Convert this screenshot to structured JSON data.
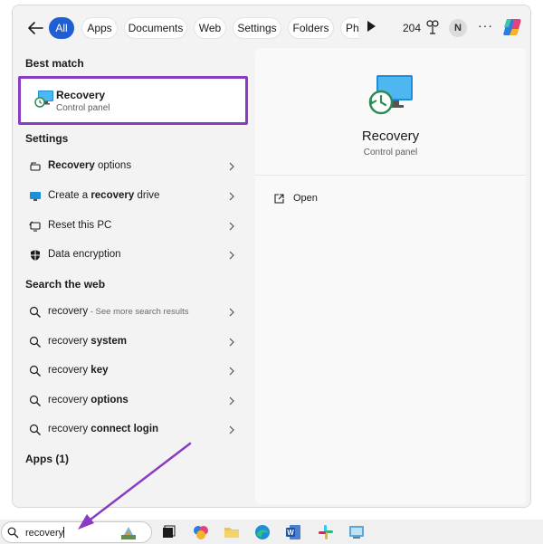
{
  "filters": {
    "tabs": [
      {
        "label": "All",
        "active": true
      },
      {
        "label": "Apps"
      },
      {
        "label": "Documents"
      },
      {
        "label": "Web"
      },
      {
        "label": "Settings"
      },
      {
        "label": "Folders"
      },
      {
        "label": "Ph"
      }
    ],
    "points": "204",
    "avatar_initial": "N",
    "more": "···"
  },
  "best_match": {
    "heading": "Best match",
    "title": "Recovery",
    "subtitle": "Control panel"
  },
  "settings": {
    "heading": "Settings",
    "items": [
      {
        "icon": "recovery-icon",
        "bold": "Recovery",
        "rest": " options"
      },
      {
        "icon": "recovery-drive-icon",
        "pre": "Create a ",
        "bold": "recovery",
        "rest": " drive"
      },
      {
        "icon": "reset-pc-icon",
        "label": "Reset this PC"
      },
      {
        "icon": "shield-icon",
        "label": "Data encryption"
      }
    ]
  },
  "web": {
    "heading": "Search the web",
    "items": [
      {
        "pre": "recovery",
        "note": " - See more search results"
      },
      {
        "pre": "recovery ",
        "bold": "system"
      },
      {
        "pre": "recovery ",
        "bold": "key"
      },
      {
        "pre": "recovery ",
        "bold": "options"
      },
      {
        "pre": "recovery ",
        "bold": "connect login"
      }
    ]
  },
  "apps": {
    "heading": "Apps (1)"
  },
  "detail": {
    "title": "Recovery",
    "subtitle": "Control panel",
    "open_label": "Open"
  },
  "taskbar": {
    "search_value": "recovery",
    "icons": [
      "widgets-icon",
      "task-view-icon",
      "copilot-icon",
      "file-explorer-icon",
      "edge-icon",
      "word-icon",
      "slack-icon",
      "control-panel-icon"
    ]
  },
  "colors": {
    "accent": "#1f5fd3",
    "highlight": "#8a3bc4",
    "panel": "#f3f3f3"
  }
}
